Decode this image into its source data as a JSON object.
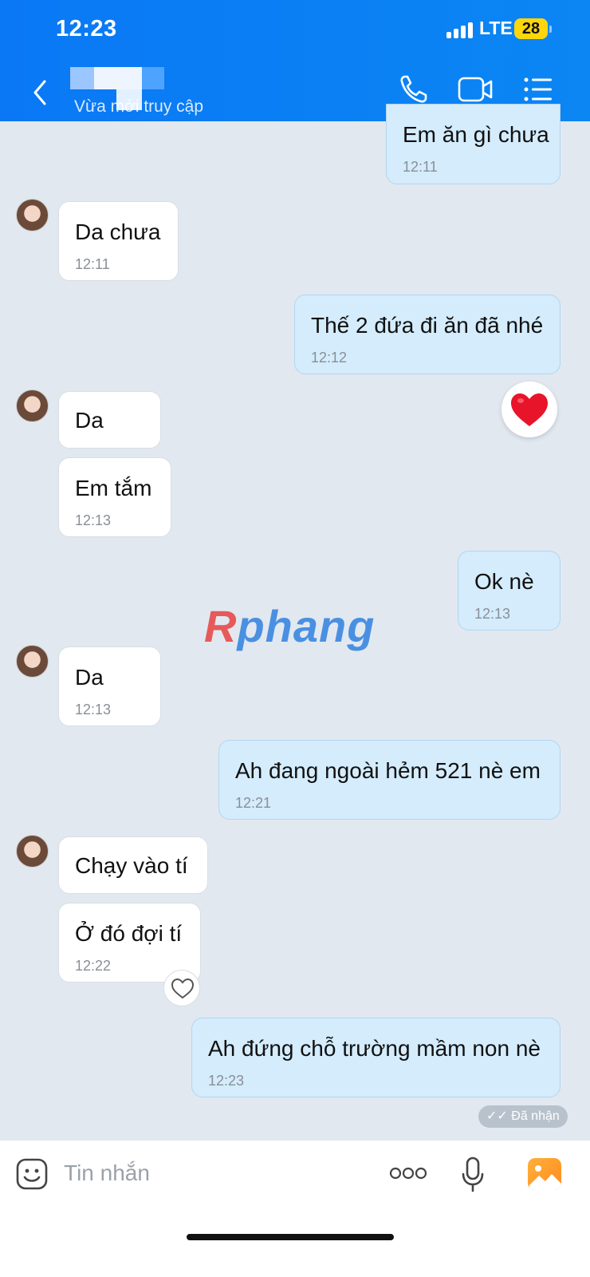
{
  "status_bar": {
    "time": "12:23",
    "network": "LTE",
    "battery": "28"
  },
  "header": {
    "contact_name": "",
    "last_seen": "Vừa mới truy cập",
    "icons": [
      "back-icon",
      "phone-icon",
      "video-call-icon",
      "menu-list-icon"
    ]
  },
  "messages": [
    {
      "dir": "out",
      "text": "Em ăn gì chưa",
      "time": "12:11"
    },
    {
      "dir": "in",
      "text": "Da chưa",
      "time": "12:11"
    },
    {
      "dir": "out",
      "text": "Thế 2 đứa đi ăn đã nhé",
      "time": "12:12",
      "reaction": "heart"
    },
    {
      "dir": "in",
      "text": "Da",
      "time": ""
    },
    {
      "dir": "in",
      "text": "Em tắm",
      "time": "12:13"
    },
    {
      "dir": "out",
      "text": "Ok nè",
      "time": "12:13"
    },
    {
      "dir": "in",
      "text": "Da",
      "time": "12:13"
    },
    {
      "dir": "out",
      "text": "Ah đang ngoài hẻm 521 nè em",
      "time": "12:21"
    },
    {
      "dir": "in",
      "text": "Chạy vào tí",
      "time": ""
    },
    {
      "dir": "in",
      "text": "Ở đó đợi tí",
      "time": "12:22"
    },
    {
      "dir": "out",
      "text": "Ah đứng chỗ trường mầm non nè",
      "time": "12:23"
    }
  ],
  "watermark": {
    "first": "R",
    "rest": "phang"
  },
  "receipt": "Đã nhận",
  "input": {
    "placeholder": "Tin nhắn"
  },
  "colors": {
    "header": "#0a78f5",
    "outgoing": "#d4ecfc",
    "incoming": "#ffffff",
    "background": "#e2e8f0"
  }
}
